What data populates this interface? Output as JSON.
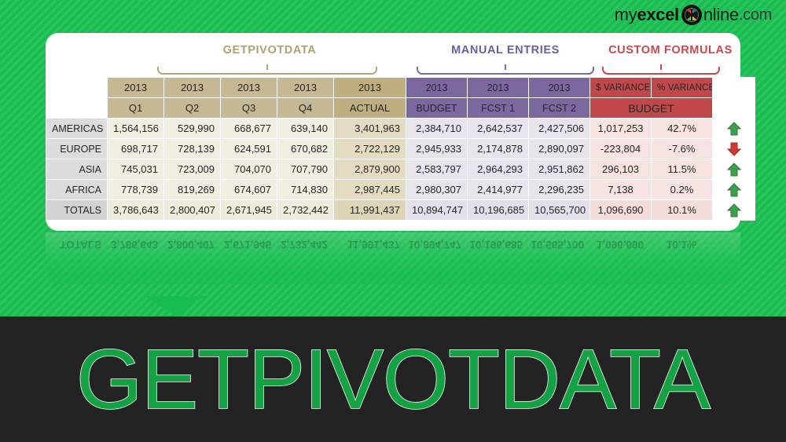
{
  "logo": {
    "part1": "my",
    "part2": "excel",
    "icon": "x-mark-icon",
    "part3": "nline",
    "part4": ".com"
  },
  "captions": {
    "getpivotdata": "GETPIVOTDATA",
    "manual": "MANUAL ENTRIES",
    "custom": "CUSTOM FORMULAS"
  },
  "colors": {
    "green": "#18bd50",
    "gold": "#c5b893",
    "purple": "#7a689f",
    "red": "#c0484b",
    "dark": "#232323",
    "title_green": "#14a245"
  },
  "table": {
    "corner_label": "",
    "header_top": [
      "2013",
      "2013",
      "2013",
      "2013",
      "2013",
      "2013",
      "2013",
      "2013",
      "$ VARIANCE",
      "% VARIANCE"
    ],
    "header_bottom": [
      "Q1",
      "Q2",
      "Q3",
      "Q4",
      "ACTUAL",
      "BUDGET",
      "FCST 1",
      "FCST 2",
      "BUDGET"
    ],
    "rows": [
      {
        "label": "AMERICAS",
        "q1": "1,564,156",
        "q2": "529,990",
        "q3": "668,677",
        "q4": "639,140",
        "actual": "3,401,963",
        "budget": "2,384,710",
        "fcst1": "2,642,537",
        "fcst2": "2,427,506",
        "dvar": "1,017,253",
        "pvar": "42.7%",
        "trend": "up",
        "negative": false
      },
      {
        "label": "EUROPE",
        "q1": "698,717",
        "q2": "728,139",
        "q3": "624,591",
        "q4": "670,682",
        "actual": "2,722,129",
        "budget": "2,945,933",
        "fcst1": "2,174,878",
        "fcst2": "2,890,097",
        "dvar": "-223,804",
        "pvar": "-7.6%",
        "trend": "down",
        "negative": true
      },
      {
        "label": "ASIA",
        "q1": "745,031",
        "q2": "723,009",
        "q3": "704,070",
        "q4": "707,790",
        "actual": "2,879,900",
        "budget": "2,583,797",
        "fcst1": "2,964,293",
        "fcst2": "2,951,862",
        "dvar": "296,103",
        "pvar": "11.5%",
        "trend": "up",
        "negative": false
      },
      {
        "label": "AFRICA",
        "q1": "778,739",
        "q2": "819,269",
        "q3": "674,607",
        "q4": "714,830",
        "actual": "2,987,445",
        "budget": "2,980,307",
        "fcst1": "2,414,977",
        "fcst2": "2,296,235",
        "dvar": "7,138",
        "pvar": "0.2%",
        "trend": "up",
        "negative": false
      }
    ],
    "totals": {
      "label": "TOTALS",
      "q1": "3,786,643",
      "q2": "2,800,407",
      "q3": "2,671,945",
      "q4": "2,732,442",
      "actual": "11,991,437",
      "budget": "10,894,747",
      "fcst1": "10,196,685",
      "fcst2": "10,565,700",
      "dvar": "1,096,690",
      "pvar": "10.1%",
      "trend": "up",
      "negative": false
    }
  },
  "big_title": "GETPIVOTDATA"
}
